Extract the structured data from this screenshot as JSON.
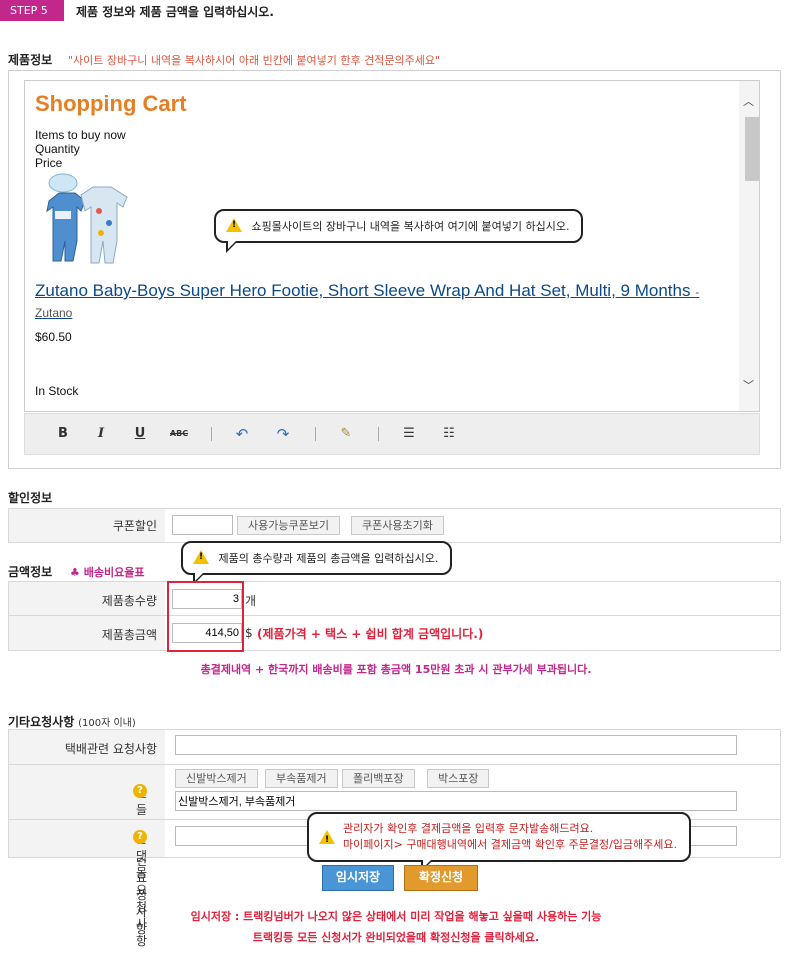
{
  "header": {
    "step_badge": "STEP 5",
    "title": "제품 정보와 제품 금액을 입력하십시오."
  },
  "product_section": {
    "title": "제품정보",
    "note": "\"사이트 장바구니 내역을 복사하시어 아래 빈칸에 붙여넣기 한후 견적문의주세요\"",
    "editor": {
      "cart_title": "Shopping Cart",
      "line1": "Items to buy now",
      "line2": "Quantity",
      "line3": "Price",
      "product_name": "Zutano Baby-Boys Super Hero Footie, Short Sleeve Wrap And Hat Set, Multi, 9 Months",
      "brand": "- Zutano",
      "price": "$60.50",
      "stock": "In Stock",
      "tooltip": "쇼핑몰사이트의 장바구니 내역을 복사하여 여기에 붙여넣기 하십시오."
    },
    "toolbar": {
      "bold": "B",
      "italic": "I",
      "underline": "U",
      "strike": "ABC"
    }
  },
  "discount_section": {
    "title": "할인정보",
    "coupon_label": "쿠폰할인",
    "coupon_value": "",
    "view_coupons_button": "사용가능쿠폰보기",
    "reset_coupon_button": "쿠폰사용초기화"
  },
  "amount_section": {
    "title": "금액정보",
    "shipping_link": "배송비요율표",
    "tooltip": "제품의 총수량과 제품의 총금액을 입력하십시오.",
    "qty_label": "제품총수량",
    "qty_value": "3",
    "qty_unit": "개",
    "total_label": "제품총금액",
    "total_value": "414,50",
    "total_unit": "$",
    "total_note": "(제품가격 + 택스 + 쉽비 합계 금액입니다.)",
    "customs_note": "총결제내역 + 한국까지 배송비를 포함 총금액 15만원 초과 시 관부가세 부과됩니다."
  },
  "request_section": {
    "title": "기타요청사항",
    "subtitle": "(100자 이내)",
    "delivery_label": "택배관련 요청사항",
    "delivery_value": "",
    "handling_label": "핸들링관련요청사항",
    "handling_buttons": [
      "신발박스제거",
      "부속품제거",
      "폴리백포장",
      "박스포장"
    ],
    "handling_value": "신발박스제거, 부속품제거",
    "mall_label": "몰댓몰 요청사항",
    "mall_value": "",
    "tooltip_line1": "관리자가 확인후 결제금액을 입력후 문자발송해드려요.",
    "tooltip_line2": "마이페이지> 구매대행내역에서  결제금액 확인후 주문결정/입금해주세요."
  },
  "actions": {
    "save_button": "임시저장",
    "confirm_button": "확정신청"
  },
  "footer": {
    "line1": "임시저장 : 트랙킹넘버가 나오지 않은 상태에서 미리 작업을 해놓고 싶을때 사용하는 기능",
    "line2": "트랙킹등 모든 신청서가 완비되었을때 확정신청을 클릭하세요."
  },
  "colors": {
    "accent_magenta": "#c2278c",
    "cart_title_orange": "#e67e22",
    "link_blue": "#0b4a8a",
    "warning_red": "#e0233d"
  }
}
